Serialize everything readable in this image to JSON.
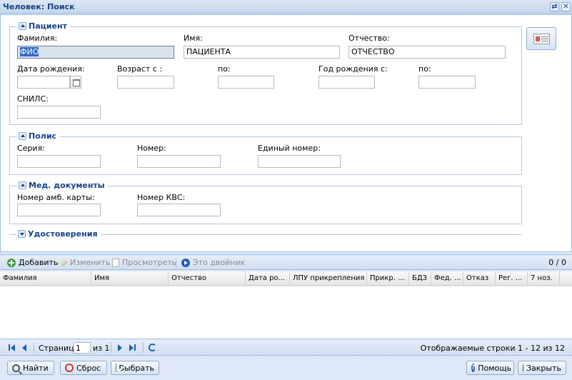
{
  "window": {
    "title": "Человек: Поиск",
    "tool_help_icon": "⇄",
    "tool_close_icon": "✕"
  },
  "patient": {
    "legend": "Пациент",
    "surname_label": "Фамилия:",
    "surname_value": "ФИО",
    "name_label": "Имя:",
    "name_value": "ПАЦИЕНТА",
    "patronymic_label": "Отчество:",
    "patronymic_value": "ОТЧЕСТВО",
    "birth_date_label": "Дата рождения:",
    "age_from_label": "Возраст с :",
    "age_to_label": "по:",
    "birth_year_from_label": "Год рождения с:",
    "birth_year_to_label": "по:",
    "snils_label": "СНИЛС:"
  },
  "policy": {
    "legend": "Полис",
    "series_label": "Серия:",
    "number_label": "Номер:",
    "unified_number_label": "Единый номер:"
  },
  "med_docs": {
    "legend": "Мед. документы",
    "amb_card_label": "Номер амб. карты:",
    "kvs_label": "Номер КВС:"
  },
  "certificates": {
    "legend": "Удостоверения"
  },
  "grid_toolbar": {
    "add_label": "Добавить",
    "edit_label": "Изменить",
    "view_label": "Просмотреть",
    "twin_label": "Это двойник",
    "count": "0 / 0"
  },
  "grid": {
    "columns": [
      "Фамилия",
      "Имя",
      "Отчество",
      "Дата ро...",
      "ЛПУ прикрепления",
      "Прикр. ...",
      "БДЗ",
      "Фед. ...",
      "Отказ",
      "Рег. ...",
      "7 ноз."
    ]
  },
  "paging": {
    "page_label": "Страница",
    "page_value": "1",
    "of_label": "из 1",
    "display_info": "Отображаемые строки 1 - 12 из 12"
  },
  "footer": {
    "find_label": "Найти",
    "reset_label": "Сброс",
    "select_label": "Выбрать",
    "help_label": "Помощь",
    "close_label": "Закрыть"
  }
}
